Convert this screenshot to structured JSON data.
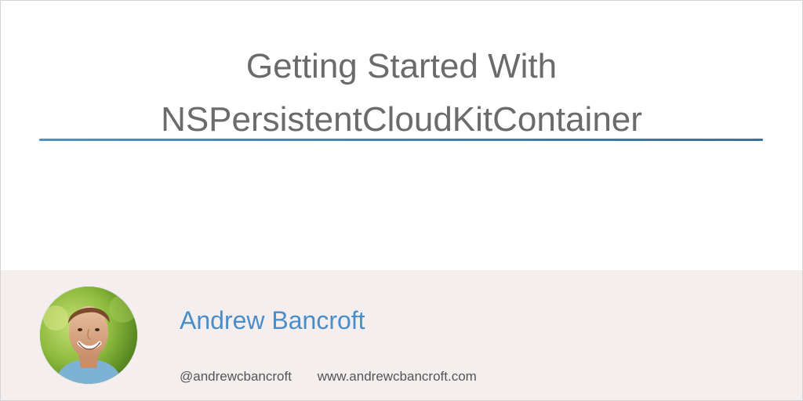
{
  "post": {
    "title_line_1": "Getting Started With",
    "title_line_2": "NSPersistentCloudKitContainer"
  },
  "author": {
    "name": "Andrew Bancroft",
    "handle": "@andrewcbancroft",
    "website": "www.andrewcbancroft.com"
  },
  "colors": {
    "title_text": "#6b6b6b",
    "accent_blue": "#4a8dc8",
    "divider_start": "#4e8fc4",
    "divider_end": "#3b6f98",
    "footer_background": "#f4efee"
  },
  "icons": {
    "avatar": "author-photo"
  }
}
